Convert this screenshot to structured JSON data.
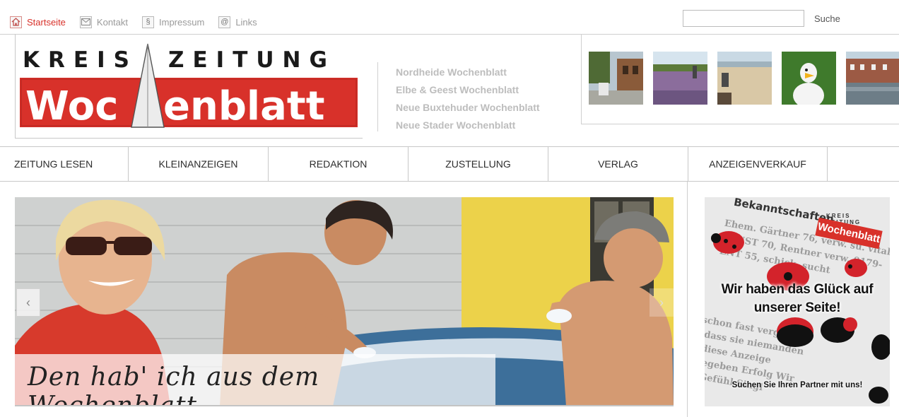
{
  "topnav": {
    "items": [
      {
        "label": "Startseite",
        "icon": "home-icon",
        "active": true
      },
      {
        "label": "Kontakt",
        "icon": "envelope-icon"
      },
      {
        "label": "Impressum",
        "icon": "section-sign-icon",
        "glyph": "§"
      },
      {
        "label": "Links",
        "icon": "at-sign-icon",
        "glyph": "@"
      }
    ]
  },
  "search": {
    "value": "",
    "button_label": "Suche"
  },
  "logo": {
    "line1": "KREIS ZEITUNG",
    "line2": "Wochenblatt"
  },
  "editions": [
    "Nordheide Wochenblatt",
    "Elbe & Geest Wochenblatt",
    "Neue Buxtehuder Wochenblatt",
    "Neue Stader Wochenblatt"
  ],
  "gallery": [
    "town-square-photo",
    "heath-photo",
    "beach-photo",
    "mascot-photo",
    "harbour-photo"
  ],
  "mainnav": [
    "ZEITUNG LESEN",
    "KLEINANZEIGEN",
    "REDAKTION",
    "ZUSTELLUNG",
    "VERLAG",
    "ANZEIGENVERKAUF"
  ],
  "slider": {
    "caption": "Den hab' ich aus dem Wochenblatt",
    "prev_glyph": "‹",
    "next_glyph": "›"
  },
  "ad": {
    "headline_1": "Wir haben das Glück auf",
    "headline_2": "unserer Seite!",
    "subline": "Suchen Sie Ihren Partner mit uns!",
    "logo_small": "KREIS ZEITUNG",
    "logo_big": "Wochenblatt",
    "paper_heading": "Bekanntschaften"
  },
  "colors": {
    "brand_red": "#d8312a",
    "active_link": "#d8312a",
    "muted_text": "#bdbdbd"
  }
}
